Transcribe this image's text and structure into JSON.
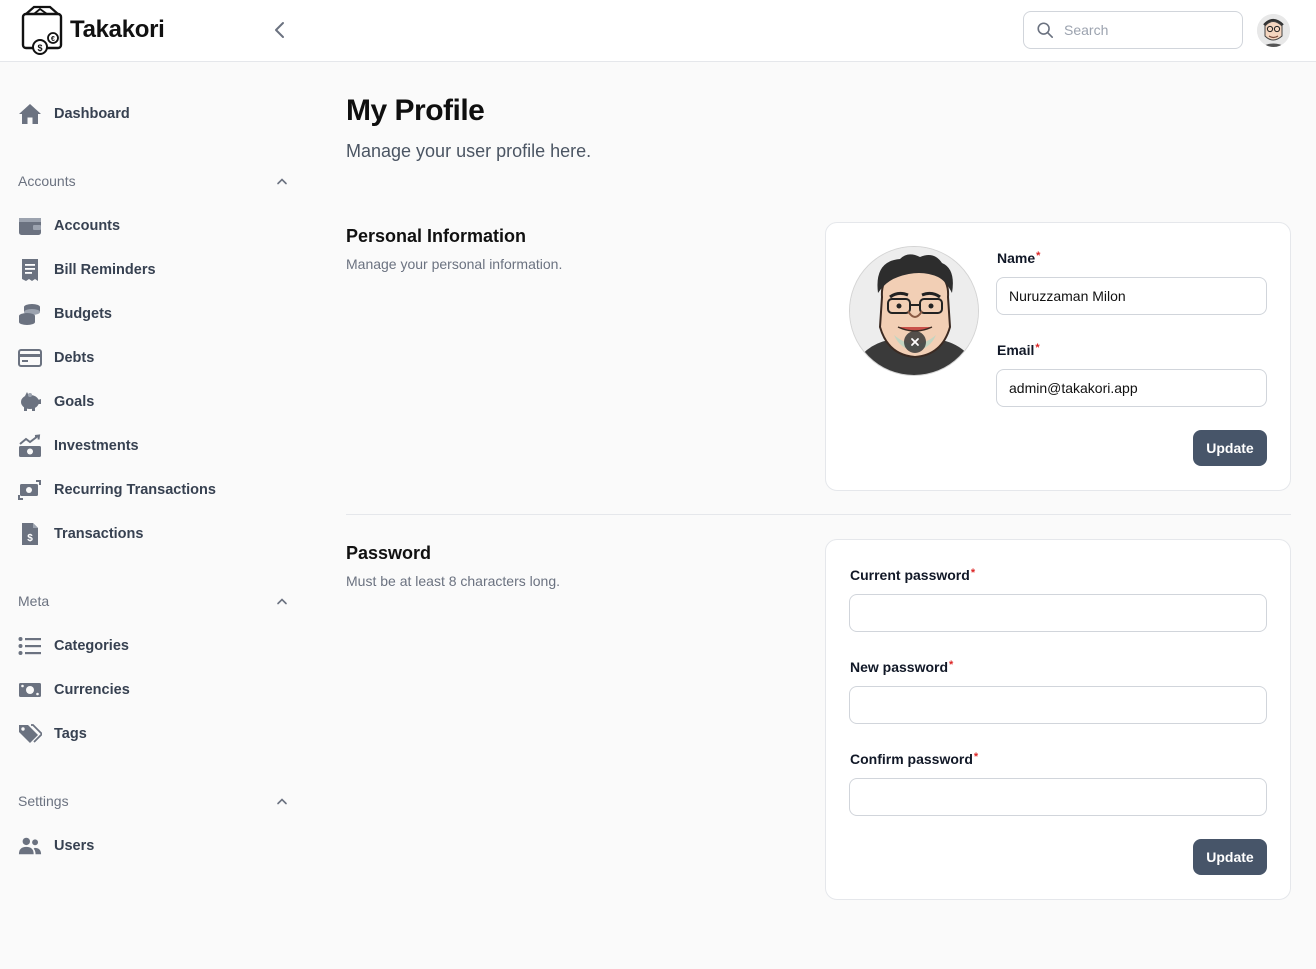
{
  "app": {
    "name": "Takakori"
  },
  "header": {
    "search_placeholder": "Search"
  },
  "sidebar": {
    "dashboard": "Dashboard",
    "groups": [
      {
        "label": "Accounts",
        "items": [
          "Accounts",
          "Bill Reminders",
          "Budgets",
          "Debts",
          "Goals",
          "Investments",
          "Recurring Transactions",
          "Transactions"
        ]
      },
      {
        "label": "Meta",
        "items": [
          "Categories",
          "Currencies",
          "Tags"
        ]
      },
      {
        "label": "Settings",
        "items": [
          "Users"
        ]
      }
    ]
  },
  "page": {
    "title": "My Profile",
    "subtitle": "Manage your user profile here."
  },
  "personal": {
    "title": "Personal Information",
    "description": "Manage your personal information.",
    "name_label": "Name",
    "name_value": "Nuruzzaman Milon",
    "email_label": "Email",
    "email_value": "admin@takakori.app",
    "submit": "Update"
  },
  "password": {
    "title": "Password",
    "description": "Must be at least 8 characters long.",
    "current_label": "Current password",
    "new_label": "New password",
    "confirm_label": "Confirm password",
    "submit": "Update"
  },
  "colors": {
    "button": "#475569",
    "required": "#dc2626",
    "icon": "#6b7280"
  }
}
